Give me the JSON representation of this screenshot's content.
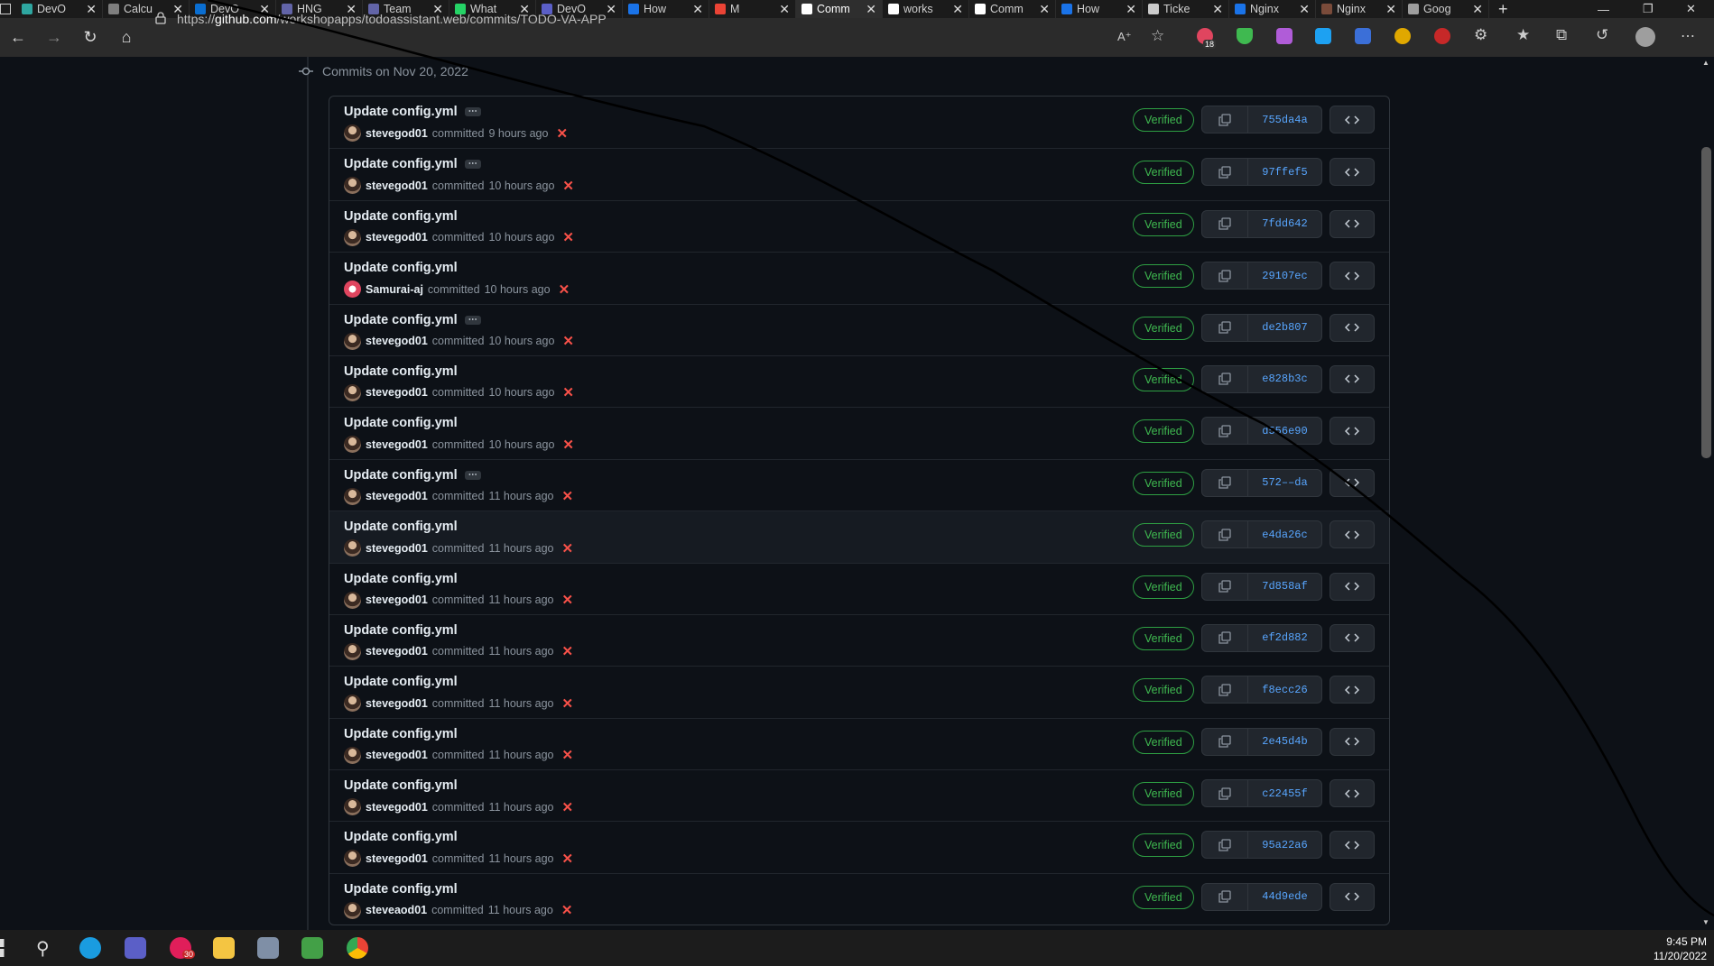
{
  "browser": {
    "tabs": [
      {
        "label": "DevO",
        "color": "#2ea6a0"
      },
      {
        "label": "Calcu",
        "color": "#7f7f7f"
      },
      {
        "label": "DevO",
        "color": "#0a6ed1"
      },
      {
        "label": "HNG",
        "color": "#6264a7"
      },
      {
        "label": "Team",
        "color": "#6264a7"
      },
      {
        "label": "What",
        "color": "#25d366"
      },
      {
        "label": "DevO",
        "color": "#5b5fc7"
      },
      {
        "label": "How",
        "color": "#1a73e8"
      },
      {
        "label": "M",
        "color": "#ea4335"
      },
      {
        "label": "Comm",
        "color": "#ffffff"
      },
      {
        "label": "works",
        "color": "#ffffff"
      },
      {
        "label": "Comm",
        "color": "#ffffff"
      },
      {
        "label": "How",
        "color": "#1a73e8"
      },
      {
        "label": "Ticke",
        "color": "#cccccc"
      },
      {
        "label": "Nginx",
        "color": "#1a73e8"
      },
      {
        "label": "Nginx",
        "color": "#7a4b3a"
      },
      {
        "label": "Goog",
        "color": "#9e9e9e"
      }
    ],
    "active_tab_index": 9,
    "url_prefix": "https://",
    "url_host": "github.com",
    "url_path": "/workshopapps/todoassistant.web/commits/TODO-VA-APP",
    "extension_badge": "18"
  },
  "page": {
    "date_heading": "Commits on Nov 20, 2022",
    "committed_word": "committed",
    "verified_label": "Verified",
    "commits": [
      {
        "message": "Update config.yml",
        "ellipsis": true,
        "author": "stevegod01",
        "time": "9 hours ago",
        "sha": "755da4a"
      },
      {
        "message": "Update config.yml",
        "ellipsis": true,
        "author": "stevegod01",
        "time": "10 hours ago",
        "sha": "97ffef5"
      },
      {
        "message": "Update config.yml",
        "ellipsis": false,
        "author": "stevegod01",
        "time": "10 hours ago",
        "sha": "7fdd642"
      },
      {
        "message": "Update config.yml",
        "ellipsis": false,
        "author": "Samurai-aj",
        "time": "10 hours ago",
        "sha": "29107ec"
      },
      {
        "message": "Update config.yml",
        "ellipsis": true,
        "author": "stevegod01",
        "time": "10 hours ago",
        "sha": "de2b807"
      },
      {
        "message": "Update config.yml",
        "ellipsis": false,
        "author": "stevegod01",
        "time": "10 hours ago",
        "sha": "e828b3c"
      },
      {
        "message": "Update config.yml",
        "ellipsis": false,
        "author": "stevegod01",
        "time": "10 hours ago",
        "sha": "d556e90"
      },
      {
        "message": "Update config.yml",
        "ellipsis": true,
        "author": "stevegod01",
        "time": "11 hours ago",
        "sha": "572––da"
      },
      {
        "message": "Update config.yml",
        "ellipsis": false,
        "author": "stevegod01",
        "time": "11 hours ago",
        "sha": "e4da26c"
      },
      {
        "message": "Update config.yml",
        "ellipsis": false,
        "author": "stevegod01",
        "time": "11 hours ago",
        "sha": "7d858af"
      },
      {
        "message": "Update config.yml",
        "ellipsis": false,
        "author": "stevegod01",
        "time": "11 hours ago",
        "sha": "ef2d882"
      },
      {
        "message": "Update config.yml",
        "ellipsis": false,
        "author": "stevegod01",
        "time": "11 hours ago",
        "sha": "f8ecc26"
      },
      {
        "message": "Update config.yml",
        "ellipsis": false,
        "author": "stevegod01",
        "time": "11 hours ago",
        "sha": "2e45d4b"
      },
      {
        "message": "Update config.yml",
        "ellipsis": false,
        "author": "stevegod01",
        "time": "11 hours ago",
        "sha": "c22455f"
      },
      {
        "message": "Update config.yml",
        "ellipsis": false,
        "author": "stevegod01",
        "time": "11 hours ago",
        "sha": "95a22a6"
      },
      {
        "message": "Update config.yml",
        "ellipsis": false,
        "author": "steveaod01",
        "time": "11 hours ago",
        "sha": "44d9ede"
      }
    ]
  },
  "taskbar": {
    "time": "9:45 PM",
    "date": "11/20/2022",
    "chat_badge": "30"
  }
}
